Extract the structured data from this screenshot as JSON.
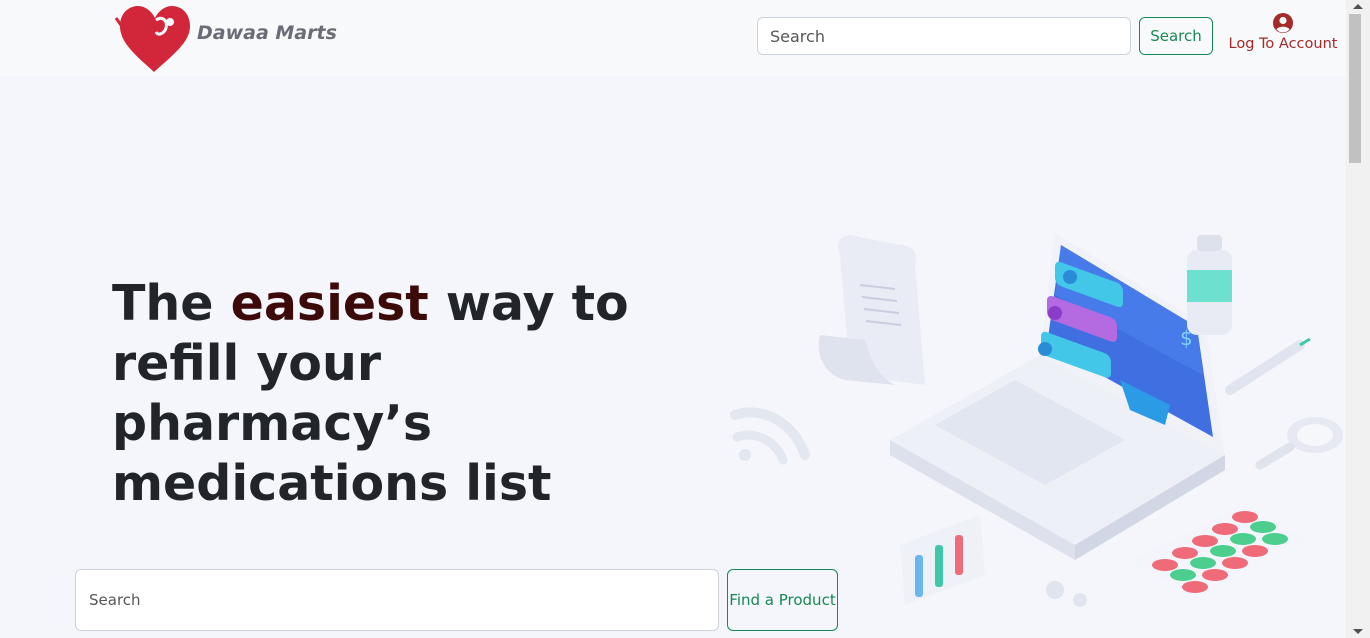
{
  "navbar": {
    "brand": "Dawaa Marts",
    "search_placeholder": "Search",
    "search_button": "Search",
    "account_label": "Log To Account"
  },
  "hero": {
    "title_prefix": "The ",
    "title_accent": "easiest",
    "title_suffix": " way to refill your pharmacy’s medications list",
    "search_placeholder": "Search",
    "find_button": "Find a Product"
  },
  "colors": {
    "brand_red": "#d2263a",
    "accent_dark": "#3d0a0a",
    "success_green": "#198754",
    "account_red": "#a52a2a"
  },
  "icons": {
    "logo": "heart-syringe-logo",
    "account": "user-circle-icon"
  }
}
